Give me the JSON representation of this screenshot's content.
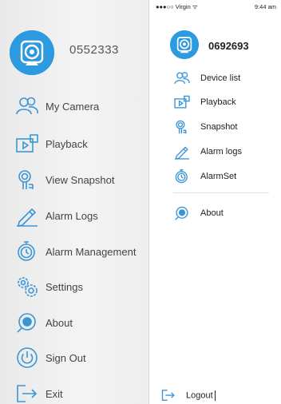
{
  "left_menu": {
    "user_id": "0552333",
    "items": [
      {
        "label": "My Camera",
        "icon": "users-icon"
      },
      {
        "label": "Playback",
        "icon": "playback-icon"
      },
      {
        "label": "View Snapshot",
        "icon": "snapshot-icon"
      },
      {
        "label": "Alarm Logs",
        "icon": "pencil-icon"
      },
      {
        "label": "Alarm Management",
        "icon": "alarm-clock-icon"
      },
      {
        "label": "Settings",
        "icon": "gears-icon"
      },
      {
        "label": "About",
        "icon": "info-icon"
      },
      {
        "label": "Sign Out",
        "icon": "power-icon"
      },
      {
        "label": "Exit",
        "icon": "exit-icon"
      }
    ]
  },
  "right_menu": {
    "status_bar": {
      "carrier": "●●●○○ Virgin ᯤ",
      "time": "9:44 am"
    },
    "user_id": "0692693",
    "items": [
      {
        "label": "Device list",
        "icon": "users-icon"
      },
      {
        "label": "Playback",
        "icon": "playback-icon"
      },
      {
        "label": "Snapshot",
        "icon": "snapshot-icon"
      },
      {
        "label": "Alarm logs",
        "icon": "pencil-icon"
      },
      {
        "label": "AlarmSet",
        "icon": "alarm-clock-icon"
      },
      {
        "label": "About",
        "icon": "info-icon"
      }
    ],
    "logout_label": "Logout"
  },
  "colors": {
    "accent": "#2d9ae0",
    "icon_stroke": "#3a96d6"
  }
}
